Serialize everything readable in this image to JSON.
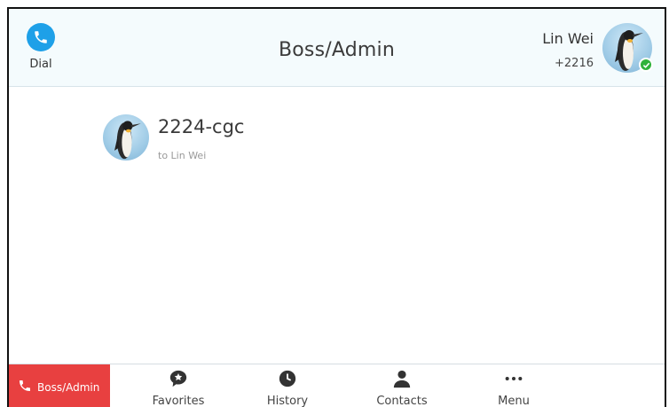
{
  "header": {
    "dial_label": "Dial",
    "title": "Boss/Admin",
    "account_name": "Lin Wei",
    "account_number": "+2216",
    "status": "online"
  },
  "calls": [
    {
      "name": "2224-cgc",
      "sub": "to Lin Wei"
    }
  ],
  "bottom": {
    "active_label": "Boss/Admin",
    "tabs": [
      {
        "label": "Favorites",
        "icon": "star-speech-icon"
      },
      {
        "label": "History",
        "icon": "clock-icon"
      },
      {
        "label": "Contacts",
        "icon": "person-icon"
      },
      {
        "label": "Menu",
        "icon": "more-dots-icon"
      }
    ]
  },
  "colors": {
    "accent_blue": "#1ea0e8",
    "active_red": "#e84040",
    "status_green": "#2fb23a",
    "header_bg": "#f4fbfd"
  }
}
